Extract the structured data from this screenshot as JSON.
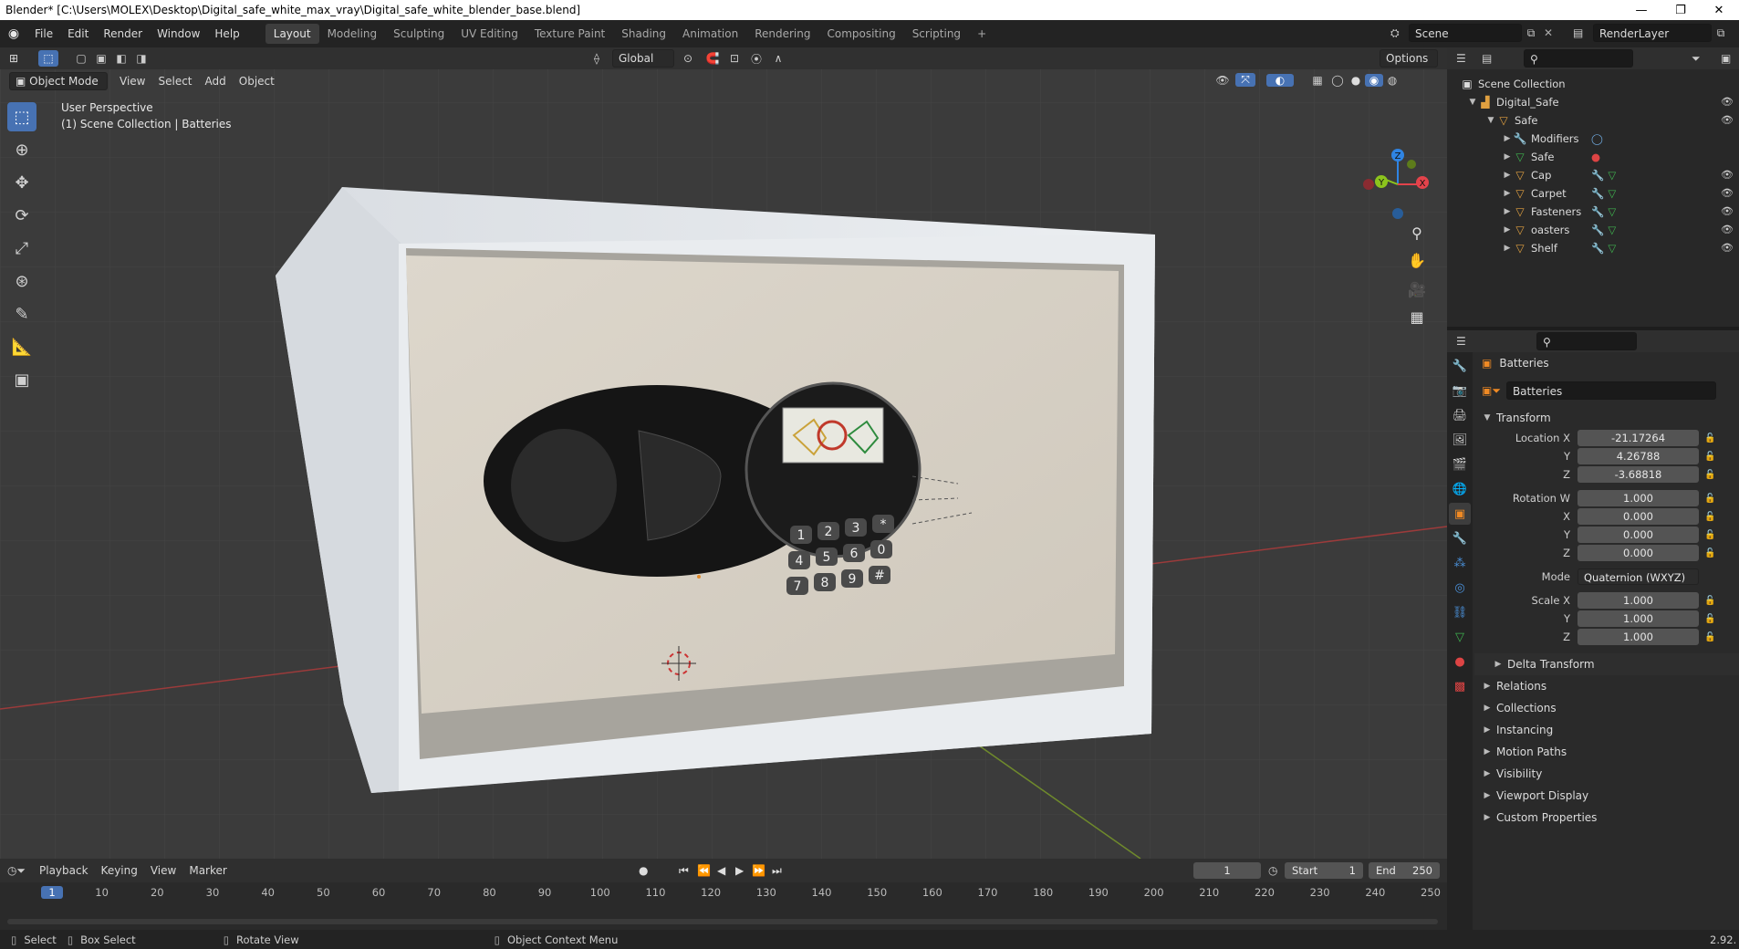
{
  "window": {
    "title": "Blender* [C:\\Users\\MOLEX\\Desktop\\Digital_safe_white_max_vray\\Digital_safe_white_blender_base.blend]",
    "minimize_glyph": "—",
    "restore_glyph": "❐",
    "close_glyph": "✕"
  },
  "menu": [
    "File",
    "Edit",
    "Render",
    "Window",
    "Help"
  ],
  "workspaces": [
    "Layout",
    "Modeling",
    "Sculpting",
    "UV Editing",
    "Texture Paint",
    "Shading",
    "Animation",
    "Rendering",
    "Compositing",
    "Scripting"
  ],
  "add_workspace": "+",
  "scene": {
    "label": "Scene",
    "view_layer": "RenderLayer"
  },
  "viewport_header": {
    "transform_orientation": "Global",
    "options_label": "Options",
    "mode": "Object Mode",
    "menus": [
      "View",
      "Select",
      "Add",
      "Object"
    ]
  },
  "viewport": {
    "perspective": "User Perspective",
    "collection_info": "(1) Scene Collection | Batteries",
    "gizmo": {
      "z": "Z",
      "y": "Y",
      "x": "X"
    }
  },
  "keypad": [
    "1",
    "2",
    "3",
    "*",
    "4",
    "5",
    "6",
    "0",
    "7",
    "8",
    "9",
    "#"
  ],
  "outliner": {
    "root": "Scene Collection",
    "collection": "Digital_Safe",
    "parent": "Safe",
    "children": [
      "Modifiers",
      "Safe",
      "Cap",
      "Carpet",
      "Fasteners",
      "oasters",
      "Shelf"
    ]
  },
  "properties": {
    "object_name": "Batteries",
    "data_name": "Batteries",
    "transform_label": "Transform",
    "location": {
      "label": "Location X",
      "x": "-21.17264",
      "y": "4.26788",
      "z": "-3.68818"
    },
    "rotation": {
      "label": "Rotation W",
      "w": "1.000",
      "x": "0.000",
      "y": "0.000",
      "z": "0.000"
    },
    "mode": {
      "label": "Mode",
      "value": "Quaternion (WXYZ)"
    },
    "scale": {
      "label": "Scale X",
      "x": "1.000",
      "y": "1.000",
      "z": "1.000"
    },
    "axis_labels": {
      "x": "X",
      "y": "Y",
      "z": "Z"
    },
    "delta": "Delta Transform",
    "sections": [
      "Relations",
      "Collections",
      "Instancing",
      "Motion Paths",
      "Visibility",
      "Viewport Display",
      "Custom Properties"
    ]
  },
  "timeline": {
    "menus": [
      "Playback",
      "Keying",
      "View",
      "Marker"
    ],
    "current_frame": "1",
    "start_label": "Start",
    "start": "1",
    "end_label": "End",
    "end": "250",
    "ruler": [
      "1",
      "10",
      "20",
      "30",
      "40",
      "50",
      "60",
      "70",
      "80",
      "90",
      "100",
      "110",
      "120",
      "130",
      "140",
      "150",
      "160",
      "170",
      "180",
      "190",
      "200",
      "210",
      "220",
      "230",
      "240",
      "250"
    ]
  },
  "statusbar": {
    "select": "Select",
    "box_select": "Box Select",
    "rotate_view": "Rotate View",
    "context_menu": "Object Context Menu",
    "version": "2.92."
  },
  "colors": {
    "accent": "#4772b3",
    "x_axis": "#e3434b",
    "y_axis": "#8cc41d",
    "z_axis": "#2f84e3",
    "active_frame": "#4772b3"
  }
}
